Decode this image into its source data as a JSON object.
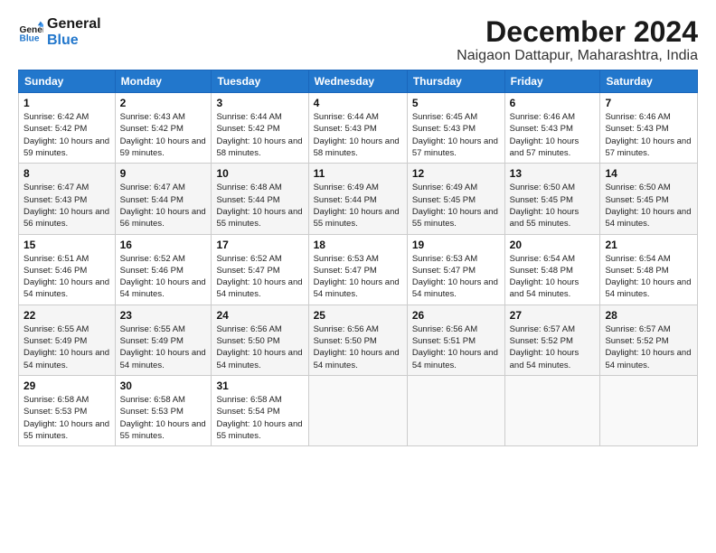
{
  "logo": {
    "line1": "General",
    "line2": "Blue"
  },
  "title": "December 2024",
  "location": "Naigaon Dattapur, Maharashtra, India",
  "days_header": [
    "Sunday",
    "Monday",
    "Tuesday",
    "Wednesday",
    "Thursday",
    "Friday",
    "Saturday"
  ],
  "weeks": [
    [
      {
        "num": "1",
        "sunrise": "Sunrise: 6:42 AM",
        "sunset": "Sunset: 5:42 PM",
        "daylight": "Daylight: 10 hours and 59 minutes."
      },
      {
        "num": "2",
        "sunrise": "Sunrise: 6:43 AM",
        "sunset": "Sunset: 5:42 PM",
        "daylight": "Daylight: 10 hours and 59 minutes."
      },
      {
        "num": "3",
        "sunrise": "Sunrise: 6:44 AM",
        "sunset": "Sunset: 5:42 PM",
        "daylight": "Daylight: 10 hours and 58 minutes."
      },
      {
        "num": "4",
        "sunrise": "Sunrise: 6:44 AM",
        "sunset": "Sunset: 5:43 PM",
        "daylight": "Daylight: 10 hours and 58 minutes."
      },
      {
        "num": "5",
        "sunrise": "Sunrise: 6:45 AM",
        "sunset": "Sunset: 5:43 PM",
        "daylight": "Daylight: 10 hours and 57 minutes."
      },
      {
        "num": "6",
        "sunrise": "Sunrise: 6:46 AM",
        "sunset": "Sunset: 5:43 PM",
        "daylight": "Daylight: 10 hours and 57 minutes."
      },
      {
        "num": "7",
        "sunrise": "Sunrise: 6:46 AM",
        "sunset": "Sunset: 5:43 PM",
        "daylight": "Daylight: 10 hours and 57 minutes."
      }
    ],
    [
      {
        "num": "8",
        "sunrise": "Sunrise: 6:47 AM",
        "sunset": "Sunset: 5:43 PM",
        "daylight": "Daylight: 10 hours and 56 minutes."
      },
      {
        "num": "9",
        "sunrise": "Sunrise: 6:47 AM",
        "sunset": "Sunset: 5:44 PM",
        "daylight": "Daylight: 10 hours and 56 minutes."
      },
      {
        "num": "10",
        "sunrise": "Sunrise: 6:48 AM",
        "sunset": "Sunset: 5:44 PM",
        "daylight": "Daylight: 10 hours and 55 minutes."
      },
      {
        "num": "11",
        "sunrise": "Sunrise: 6:49 AM",
        "sunset": "Sunset: 5:44 PM",
        "daylight": "Daylight: 10 hours and 55 minutes."
      },
      {
        "num": "12",
        "sunrise": "Sunrise: 6:49 AM",
        "sunset": "Sunset: 5:45 PM",
        "daylight": "Daylight: 10 hours and 55 minutes."
      },
      {
        "num": "13",
        "sunrise": "Sunrise: 6:50 AM",
        "sunset": "Sunset: 5:45 PM",
        "daylight": "Daylight: 10 hours and 55 minutes."
      },
      {
        "num": "14",
        "sunrise": "Sunrise: 6:50 AM",
        "sunset": "Sunset: 5:45 PM",
        "daylight": "Daylight: 10 hours and 54 minutes."
      }
    ],
    [
      {
        "num": "15",
        "sunrise": "Sunrise: 6:51 AM",
        "sunset": "Sunset: 5:46 PM",
        "daylight": "Daylight: 10 hours and 54 minutes."
      },
      {
        "num": "16",
        "sunrise": "Sunrise: 6:52 AM",
        "sunset": "Sunset: 5:46 PM",
        "daylight": "Daylight: 10 hours and 54 minutes."
      },
      {
        "num": "17",
        "sunrise": "Sunrise: 6:52 AM",
        "sunset": "Sunset: 5:47 PM",
        "daylight": "Daylight: 10 hours and 54 minutes."
      },
      {
        "num": "18",
        "sunrise": "Sunrise: 6:53 AM",
        "sunset": "Sunset: 5:47 PM",
        "daylight": "Daylight: 10 hours and 54 minutes."
      },
      {
        "num": "19",
        "sunrise": "Sunrise: 6:53 AM",
        "sunset": "Sunset: 5:47 PM",
        "daylight": "Daylight: 10 hours and 54 minutes."
      },
      {
        "num": "20",
        "sunrise": "Sunrise: 6:54 AM",
        "sunset": "Sunset: 5:48 PM",
        "daylight": "Daylight: 10 hours and 54 minutes."
      },
      {
        "num": "21",
        "sunrise": "Sunrise: 6:54 AM",
        "sunset": "Sunset: 5:48 PM",
        "daylight": "Daylight: 10 hours and 54 minutes."
      }
    ],
    [
      {
        "num": "22",
        "sunrise": "Sunrise: 6:55 AM",
        "sunset": "Sunset: 5:49 PM",
        "daylight": "Daylight: 10 hours and 54 minutes."
      },
      {
        "num": "23",
        "sunrise": "Sunrise: 6:55 AM",
        "sunset": "Sunset: 5:49 PM",
        "daylight": "Daylight: 10 hours and 54 minutes."
      },
      {
        "num": "24",
        "sunrise": "Sunrise: 6:56 AM",
        "sunset": "Sunset: 5:50 PM",
        "daylight": "Daylight: 10 hours and 54 minutes."
      },
      {
        "num": "25",
        "sunrise": "Sunrise: 6:56 AM",
        "sunset": "Sunset: 5:50 PM",
        "daylight": "Daylight: 10 hours and 54 minutes."
      },
      {
        "num": "26",
        "sunrise": "Sunrise: 6:56 AM",
        "sunset": "Sunset: 5:51 PM",
        "daylight": "Daylight: 10 hours and 54 minutes."
      },
      {
        "num": "27",
        "sunrise": "Sunrise: 6:57 AM",
        "sunset": "Sunset: 5:52 PM",
        "daylight": "Daylight: 10 hours and 54 minutes."
      },
      {
        "num": "28",
        "sunrise": "Sunrise: 6:57 AM",
        "sunset": "Sunset: 5:52 PM",
        "daylight": "Daylight: 10 hours and 54 minutes."
      }
    ],
    [
      {
        "num": "29",
        "sunrise": "Sunrise: 6:58 AM",
        "sunset": "Sunset: 5:53 PM",
        "daylight": "Daylight: 10 hours and 55 minutes."
      },
      {
        "num": "30",
        "sunrise": "Sunrise: 6:58 AM",
        "sunset": "Sunset: 5:53 PM",
        "daylight": "Daylight: 10 hours and 55 minutes."
      },
      {
        "num": "31",
        "sunrise": "Sunrise: 6:58 AM",
        "sunset": "Sunset: 5:54 PM",
        "daylight": "Daylight: 10 hours and 55 minutes."
      },
      null,
      null,
      null,
      null
    ]
  ]
}
